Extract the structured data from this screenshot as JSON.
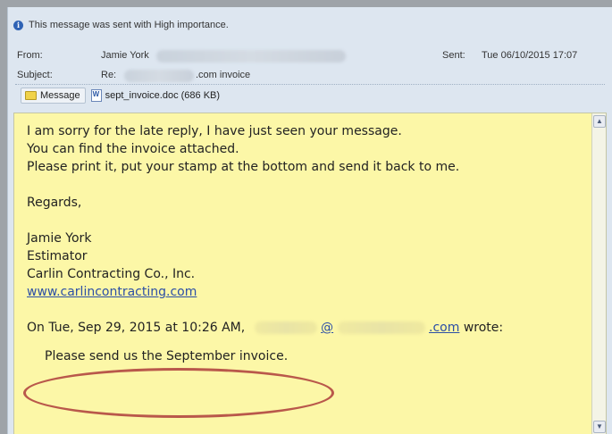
{
  "header": {
    "importance_text": "This message was sent with High importance.",
    "from_label": "From:",
    "from_value": "Jamie York",
    "sent_label": "Sent:",
    "sent_value": "Tue 06/10/2015 17:07",
    "subject_label": "Subject:",
    "subject_prefix": "Re:",
    "subject_suffix": ".com invoice"
  },
  "tabs": {
    "message_label": "Message",
    "attachment_label": "sept_invoice.doc (686 KB)"
  },
  "body": {
    "lines": [
      "I am sorry for the late reply, I have just seen your message.",
      "You can find the invoice attached.",
      "Please print it, put your stamp at the bottom and send it back to me."
    ],
    "regards": "Regards,",
    "signature_name": "Jamie York",
    "signature_title": "Estimator",
    "signature_company": "Carlin Contracting Co., Inc.",
    "signature_link": "www.carlincontracting.com",
    "quote_prefix": "On Tue, Sep 29, 2015 at 10:26 AM,",
    "quote_at": "@",
    "quote_domain": ".com",
    "quote_suffix": "wrote:",
    "quoted_text": "Please send us the September invoice."
  },
  "colors": {
    "body_background": "#fcf7a7",
    "header_background": "#dde6f0",
    "annotation_oval": "#b9584b",
    "link": "#2c4fa6"
  },
  "icons": {
    "importance": "info-icon",
    "message_tab": "envelope-icon",
    "attachment": "word-document-icon",
    "scroll_up": "scroll-up-arrow-icon",
    "scroll_down": "scroll-down-arrow-icon"
  }
}
